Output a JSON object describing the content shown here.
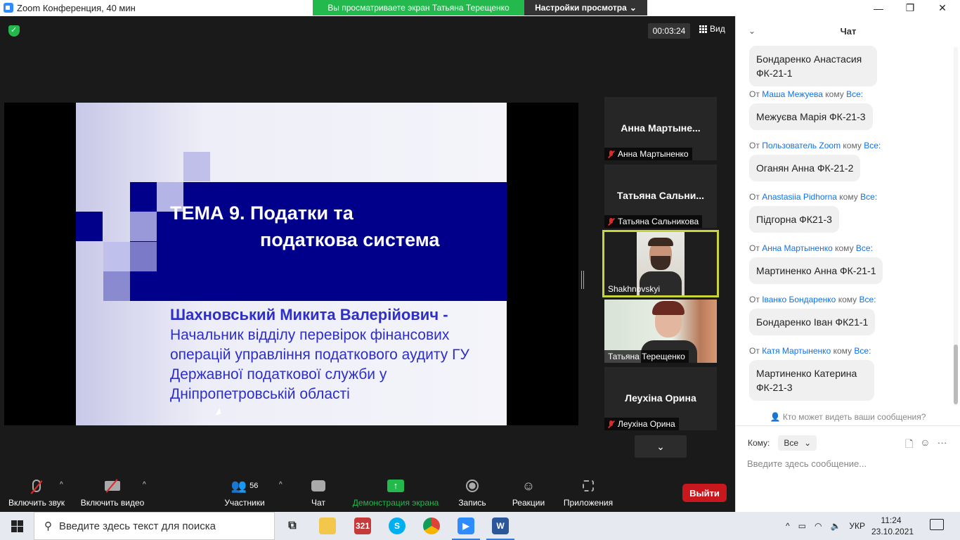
{
  "window": {
    "title": "Zoom Конференция, 40 мин",
    "share_banner": "Вы просматриваете экран Татьяна Терещенко",
    "view_settings": "Настройки просмотра",
    "controls": [
      "—",
      "❐",
      "✕"
    ]
  },
  "meeting": {
    "timer": "00:03:24",
    "view_label": "Вид"
  },
  "slide": {
    "title_line1": "ТЕМА 9. Податки та",
    "title_line2": "податкова система",
    "author": "Шахновський Микита Валерійович -",
    "description": "Начальник відділу перевірок фінансових операцій управління  податкового аудиту ГУ Державної податкової служби у Дніпропетровській області",
    "colors": {
      "band": "#00008b",
      "text": "#2e2ec8"
    }
  },
  "participants": [
    {
      "display": "Анна  Мартыне...",
      "label": "Анна Мартыненко",
      "muted": true
    },
    {
      "display": "Татьяна  Сальни...",
      "label": "Татьяна Сальникова",
      "muted": true
    },
    {
      "display": "",
      "label": "Shakhnovskyi",
      "muted": false,
      "active_speaker": true
    },
    {
      "display": "",
      "label": "Татьяна Терещенко",
      "muted": false
    },
    {
      "display": "Леухіна Орина",
      "label": "Леухіна Орина",
      "muted": true
    }
  ],
  "toolbar": {
    "audio": "Включить звук",
    "video": "Включить видео",
    "participants": "Участники",
    "participants_count": "56",
    "chat": "Чат",
    "share": "Демонстрация экрана",
    "record": "Запись",
    "reactions": "Реакции",
    "apps": "Приложения",
    "leave": "Выйти"
  },
  "chat": {
    "title": "Чат",
    "from_word": "От",
    "to_word": "кому",
    "messages": [
      {
        "from": "",
        "to": "",
        "text": "Бондаренко Анастасия ФК-21-1"
      },
      {
        "from": "Маша Межуева",
        "to": "Все:",
        "text": "Межуєва Марія ФК-21-3"
      },
      {
        "from": "Пользователь Zoom",
        "to": "Все:",
        "text": "Оганян Анна ФК-21-2"
      },
      {
        "from": "Anastasiia Pidhorna",
        "to": "Все:",
        "text": "Підгорна ФК21-3"
      },
      {
        "from": "Анна Мартыненко",
        "to": "Все:",
        "text": "Мартиненко Анна ФК-21-1"
      },
      {
        "from": "Іванко Бондаренко",
        "to": "Все:",
        "text": "Бондаренко Іван ФК21-1"
      },
      {
        "from": "Катя Мартыненко",
        "to": "Все:",
        "text": "Мартиненко Катерина ФК-21-3"
      }
    ],
    "privacy": "Кто может видеть ваши сообщения?",
    "to_label": "Кому:",
    "to_value": "Все",
    "placeholder": "Введите здесь сообщение..."
  },
  "taskbar": {
    "search_placeholder": "Введите здесь текст для поиска",
    "language": "УКР",
    "time": "11:24",
    "date": "23.10.2021"
  }
}
